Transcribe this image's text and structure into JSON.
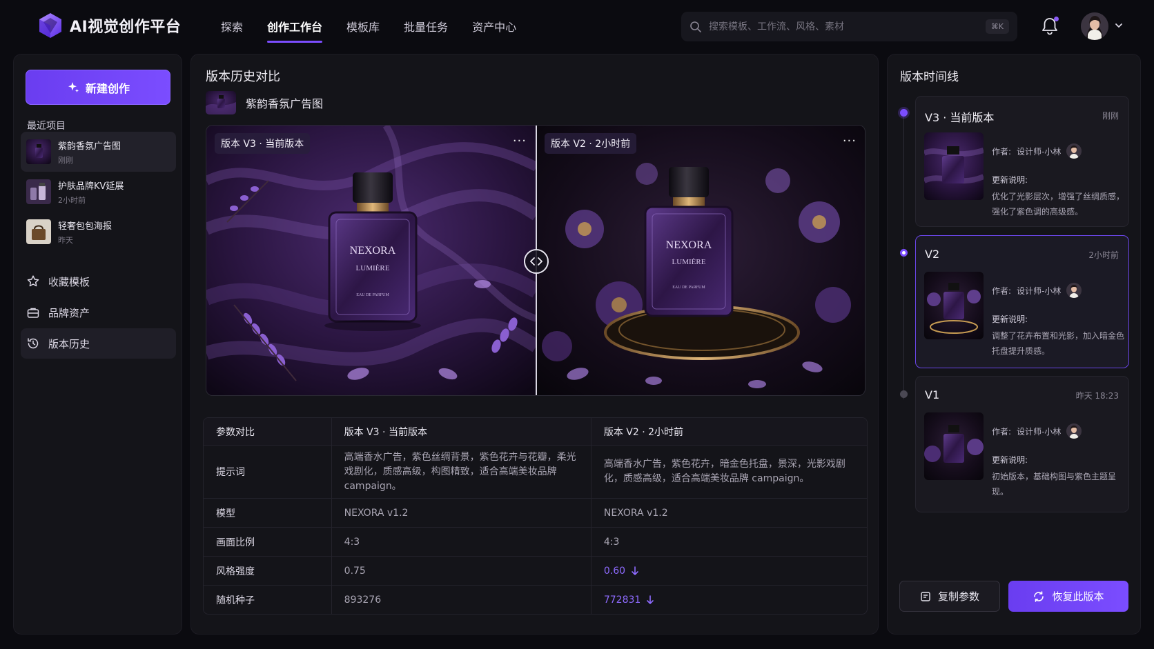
{
  "app": {
    "title": "AI视觉创作平台"
  },
  "nav": [
    "探索",
    "创作工作台",
    "模板库",
    "批量任务",
    "资产中心"
  ],
  "search": {
    "placeholder": "搜索模板、工作流、风格、素材",
    "shortcut": "⌘K"
  },
  "sidebar": {
    "new_button": "新建创作",
    "recent_label": "最近项目",
    "recent": [
      {
        "title": "紫韵香氛广告图",
        "time": "刚刚"
      },
      {
        "title": "护肤品牌KV延展",
        "time": "2小时前"
      },
      {
        "title": "轻奢包包海报",
        "time": "昨天"
      }
    ],
    "menu": [
      {
        "label": "收藏模板",
        "icon": "star-icon"
      },
      {
        "label": "品牌资产",
        "icon": "briefcase-icon"
      },
      {
        "label": "版本历史",
        "icon": "history-icon"
      }
    ]
  },
  "main": {
    "title": "版本历史对比",
    "asset_name": "紫韵香氛广告图",
    "compare": {
      "left_tag": "版本 V3 · 当前版本",
      "right_tag": "版本 V2 · 2小时前",
      "more": "···",
      "brand": "NEXORA",
      "subbrand": "LUMIÈRE",
      "eau": "EAU DE PARFUM"
    },
    "params": {
      "headers": [
        "参数对比",
        "版本 V3 · 当前版本",
        "版本 V2 · 2小时前"
      ],
      "rows": [
        {
          "label": "提示词",
          "v3": "高端香水广告，紫色丝绸背景，紫色花卉与花瓣，柔光戏剧化，质感高级，构图精致，适合高端美妆品牌 campaign。",
          "v2": "高端香水广告，紫色花卉，暗金色托盘，景深，光影戏剧化，质感高级，适合高端美妆品牌 campaign。"
        },
        {
          "label": "模型",
          "v3": "NEXORA v1.2",
          "v2": "NEXORA v1.2"
        },
        {
          "label": "画面比例",
          "v3": "4:3",
          "v2": "4:3"
        },
        {
          "label": "风格强度",
          "v3": "0.75",
          "v2": "0.60"
        },
        {
          "label": "随机种子",
          "v3": "893276",
          "v2": "772831"
        }
      ]
    }
  },
  "timeline": {
    "title": "版本时间线",
    "author_label": "作者:",
    "note_label": "更新说明:",
    "versions": [
      {
        "version": "V3 · 当前版本",
        "time": "刚刚",
        "author": "设计师-小林",
        "note": "优化了光影层次，增强了丝绸质感，强化了紫色调的高级感。"
      },
      {
        "version": "V2",
        "time": "2小时前",
        "author": "设计师-小林",
        "note": "调整了花卉布置和光影，加入暗金色托盘提升质感。"
      },
      {
        "version": "V1",
        "time": "昨天 18:23",
        "author": "设计师-小林",
        "note": "初始版本，基础构图与紫色主题呈现。"
      }
    ],
    "copy_button": "复制参数",
    "restore_button": "恢复此版本"
  },
  "colors": {
    "accent": "#7b4dff",
    "background": "#0b0b10",
    "panel": "#141419"
  }
}
